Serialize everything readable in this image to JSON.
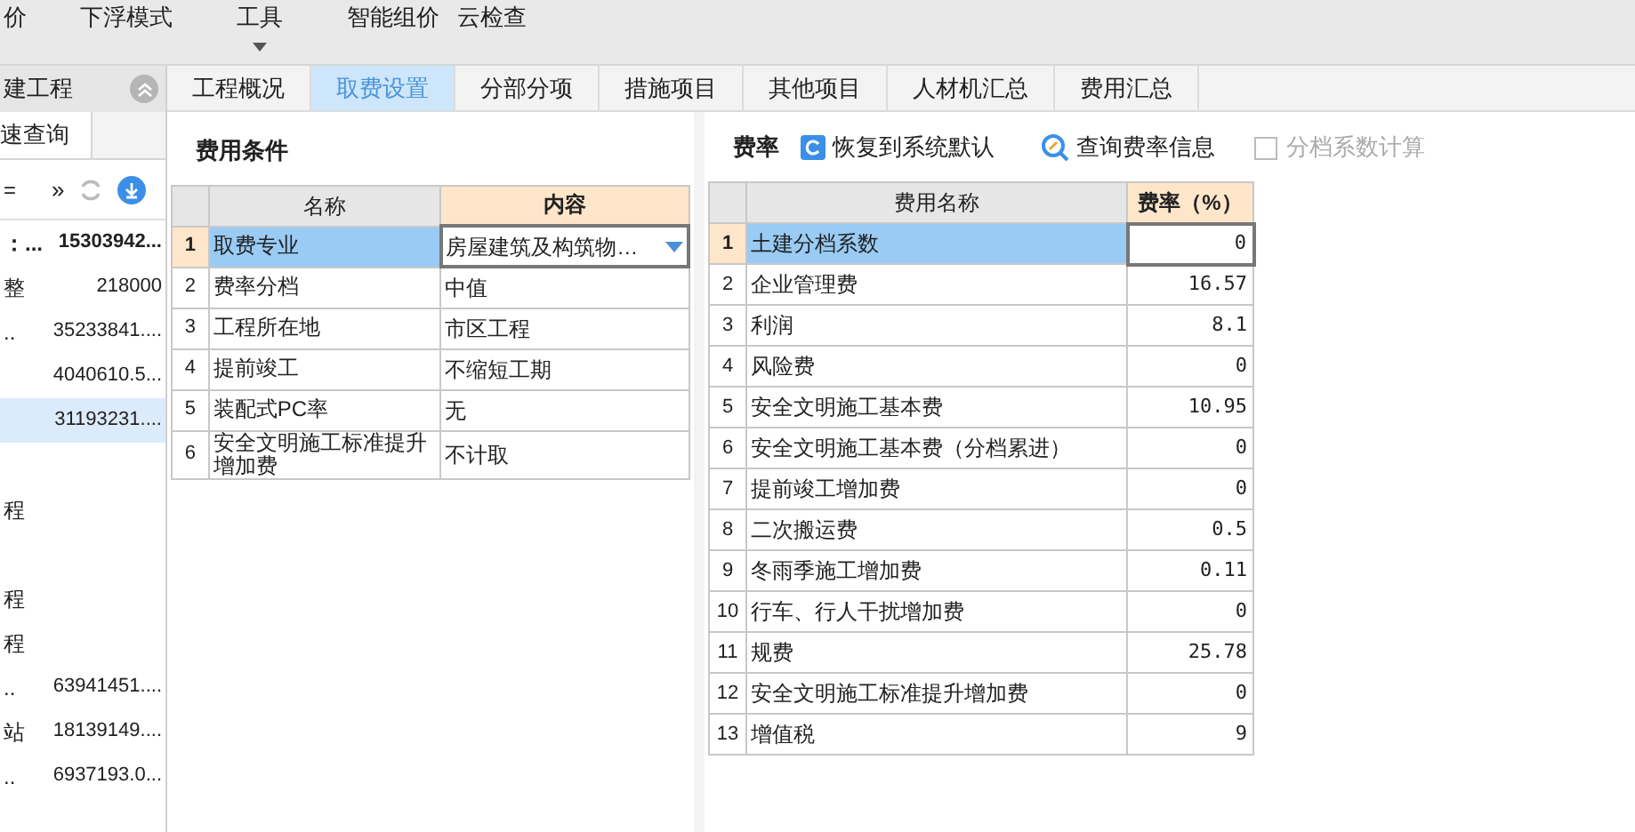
{
  "toolbar": [
    {
      "label": "价",
      "caret": false
    },
    {
      "label": "下浮模式",
      "caret": false
    },
    {
      "label": "工具",
      "caret": true
    },
    {
      "label": "智能组价",
      "caret": false
    },
    {
      "label": "云检查",
      "caret": false
    }
  ],
  "sidebar": {
    "title": "建工程",
    "tab": "速查询",
    "icon_row_text": "=",
    "more": "»",
    "rows": [
      {
        "label": "：...",
        "value": "15303942...",
        "bold": true,
        "selected": false
      },
      {
        "label": "整",
        "value": "218000",
        "bold": false,
        "selected": false
      },
      {
        "label": "..",
        "value": "35233841....",
        "bold": false,
        "selected": false
      },
      {
        "label": "",
        "value": "4040610.5...",
        "bold": false,
        "selected": false
      },
      {
        "label": "",
        "value": "31193231....",
        "bold": false,
        "selected": true
      },
      {
        "label": "程",
        "value": "",
        "bold": false,
        "selected": false,
        "gap_before": true
      },
      {
        "label": "程",
        "value": "",
        "bold": false,
        "selected": false,
        "gap_before": true
      },
      {
        "label": "程",
        "value": "",
        "bold": false,
        "selected": false
      },
      {
        "label": "..",
        "value": "63941451....",
        "bold": false,
        "selected": false
      },
      {
        "label": "站",
        "value": "18139149....",
        "bold": false,
        "selected": false
      },
      {
        "label": "..",
        "value": "6937193.0...",
        "bold": false,
        "selected": false
      }
    ]
  },
  "tabs": [
    {
      "label": "工程概况",
      "selected": false
    },
    {
      "label": "取费设置",
      "selected": true
    },
    {
      "label": "分部分项",
      "selected": false
    },
    {
      "label": "措施项目",
      "selected": false
    },
    {
      "label": "其他项目",
      "selected": false
    },
    {
      "label": "人材机汇总",
      "selected": false
    },
    {
      "label": "费用汇总",
      "selected": false
    }
  ],
  "conditions": {
    "title": "费用条件",
    "columns": [
      "名称",
      "内容"
    ],
    "rows": [
      {
        "no": "1",
        "name": "取费专业",
        "value": "房屋建筑及构筑物…",
        "dropdown": true,
        "selected": true
      },
      {
        "no": "2",
        "name": "费率分档",
        "value": "中值",
        "dropdown": false,
        "selected": false
      },
      {
        "no": "3",
        "name": "工程所在地",
        "value": "市区工程",
        "dropdown": false,
        "selected": false
      },
      {
        "no": "4",
        "name": "提前竣工",
        "value": "不缩短工期",
        "dropdown": false,
        "selected": false
      },
      {
        "no": "5",
        "name": "装配式PC率",
        "value": "无",
        "dropdown": false,
        "selected": false
      },
      {
        "no": "6",
        "name": "安全文明施工标准提升增加费",
        "value": "不计取",
        "dropdown": false,
        "selected": false
      }
    ]
  },
  "rates": {
    "title": "费率",
    "restore_button": "恢复到系统默认",
    "query_button": "查询费率信息",
    "tiered_checkbox": {
      "label": "分档系数计算",
      "checked": false,
      "disabled": true
    },
    "columns": [
      "费用名称",
      "费率（%）"
    ],
    "rows": [
      {
        "no": "1",
        "name": "土建分档系数",
        "rate": "0",
        "selected": true
      },
      {
        "no": "2",
        "name": "企业管理费",
        "rate": "16.57",
        "selected": false
      },
      {
        "no": "3",
        "name": "利润",
        "rate": "8.1",
        "selected": false
      },
      {
        "no": "4",
        "name": "风险费",
        "rate": "0",
        "selected": false
      },
      {
        "no": "5",
        "name": "安全文明施工基本费",
        "rate": "10.95",
        "selected": false
      },
      {
        "no": "6",
        "name": "安全文明施工基本费（分档累进）",
        "rate": "0",
        "selected": false
      },
      {
        "no": "7",
        "name": "提前竣工增加费",
        "rate": "0",
        "selected": false
      },
      {
        "no": "8",
        "name": "二次搬运费",
        "rate": "0.5",
        "selected": false
      },
      {
        "no": "9",
        "name": "冬雨季施工增加费",
        "rate": "0.11",
        "selected": false
      },
      {
        "no": "10",
        "name": "行车、行人干扰增加费",
        "rate": "0",
        "selected": false
      },
      {
        "no": "11",
        "name": "规费",
        "rate": "25.78",
        "selected": false
      },
      {
        "no": "12",
        "name": "安全文明施工标准提升增加费",
        "rate": "0",
        "selected": false
      },
      {
        "no": "13",
        "name": "增值税",
        "rate": "9",
        "selected": false
      }
    ]
  }
}
